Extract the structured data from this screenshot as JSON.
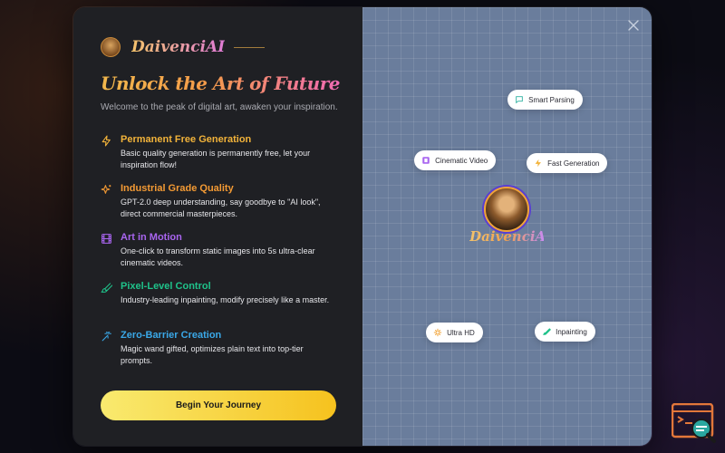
{
  "brand": {
    "name": "DaivenciAI"
  },
  "headline": "Unlock the Art of Future",
  "subtitle": "Welcome to the peak of digital art, awaken your inspiration.",
  "features": [
    {
      "title": "Permanent Free Generation",
      "desc": "Basic quality generation is permanently free, let your inspiration flow!",
      "color": "#f2b33a",
      "icon": "lightning-icon"
    },
    {
      "title": "Industrial Grade Quality",
      "desc": "GPT-2.0 deep understanding, say goodbye to \"AI look\", direct commercial masterpieces.",
      "color": "#f39a34",
      "icon": "sparkle-icon"
    },
    {
      "title": "Art in Motion",
      "desc": "One-click to transform static images into 5s ultra-clear cinematic videos.",
      "color": "#a965f0",
      "icon": "film-icon"
    },
    {
      "title": "Pixel-Level Control",
      "desc": "Industry-leading inpainting, modify precisely like a master.",
      "color": "#1fc28a",
      "icon": "brush-icon"
    },
    {
      "title": "Zero-Barrier Creation",
      "desc": "Magic wand gifted, optimizes plain text into top-tier prompts.",
      "color": "#3aa8e8",
      "icon": "magic-wand-icon"
    }
  ],
  "cta": {
    "label": "Begin Your Journey"
  },
  "chips": {
    "smart_parsing": "Smart Parsing",
    "cinematic_video": "Cinematic Video",
    "fast_generation": "Fast Generation",
    "ultra_hd": "Ultra HD",
    "inpainting": "Inpainting"
  },
  "center_logo": {
    "text": "DaivenciAI"
  },
  "colors": {
    "accent_yellow": "#f6c21e",
    "panel_dark": "#1f2024",
    "grid_bg": "#6a7d9c"
  }
}
